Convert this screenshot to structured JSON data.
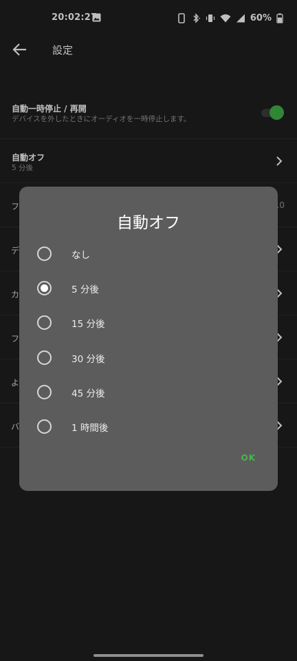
{
  "status_bar": {
    "time": "20:02:27",
    "battery": "60%",
    "icons": [
      "image-icon",
      "phone-icon",
      "bluetooth-icon",
      "vibrate-icon",
      "wifi-icon",
      "signal-icon",
      "battery-icon"
    ]
  },
  "header": {
    "title": "設定",
    "back_icon": "arrow-left-icon"
  },
  "settings": {
    "auto_pause": {
      "title": "自動一時停止 / 再開",
      "subtitle": "デバイスを外したときにオーディオを一時停止します。",
      "enabled": true
    },
    "auto_off": {
      "title": "自動オフ",
      "value": "5 分後"
    },
    "partial_rows": [
      {
        "label": "フ",
        "trail": ".0"
      },
      {
        "label": "デ"
      },
      {
        "label": "カ"
      },
      {
        "label": "フ"
      },
      {
        "label": "よ"
      },
      {
        "label": "バ"
      }
    ]
  },
  "dialog": {
    "title": "自動オフ",
    "options": [
      {
        "label": "なし",
        "selected": false
      },
      {
        "label": "5 分後",
        "selected": true
      },
      {
        "label": "15 分後",
        "selected": false
      },
      {
        "label": "30 分後",
        "selected": false
      },
      {
        "label": "45 分後",
        "selected": false
      },
      {
        "label": "1 時間後",
        "selected": false
      }
    ],
    "ok_label": "OK"
  },
  "colors": {
    "accent": "#46b64e",
    "dialog_bg": "#5c5c5c",
    "page_bg": "#1f1f1f"
  }
}
